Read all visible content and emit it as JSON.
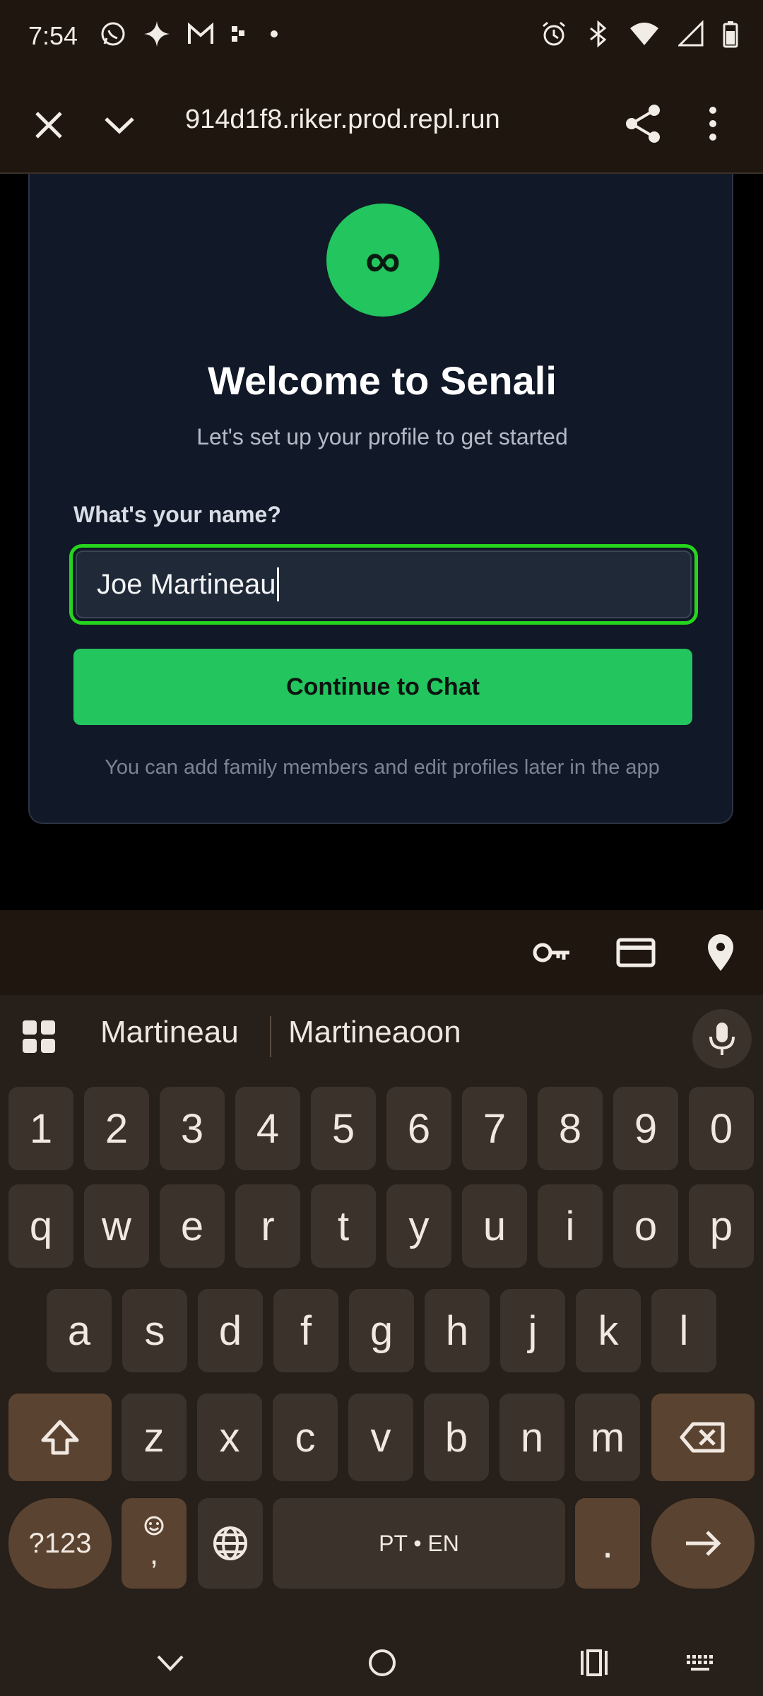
{
  "status_bar": {
    "time": "7:54"
  },
  "browser": {
    "url": "914d1f8.riker.prod.repl.run"
  },
  "card": {
    "logo_symbol": "∞",
    "title": "Welcome to Senali",
    "subtitle": "Let's set up your profile to get started",
    "name_label": "What's your name?",
    "name_value": "Joe Martineau",
    "continue_label": "Continue to Chat",
    "hint": "You can add family members and edit profiles later in the app"
  },
  "keyboard": {
    "suggestions": [
      "Martineau",
      "Martineaoon"
    ],
    "row_numbers": [
      "1",
      "2",
      "3",
      "4",
      "5",
      "6",
      "7",
      "8",
      "9",
      "0"
    ],
    "row1": [
      "q",
      "w",
      "e",
      "r",
      "t",
      "y",
      "u",
      "i",
      "o",
      "p"
    ],
    "row2": [
      "a",
      "s",
      "d",
      "f",
      "g",
      "h",
      "j",
      "k",
      "l"
    ],
    "row3": [
      "z",
      "x",
      "c",
      "v",
      "b",
      "n",
      "m"
    ],
    "symbols_label": "?123",
    "comma_label": ",",
    "space_label": "PT • EN",
    "period_label": "."
  },
  "icons": {
    "status": [
      "whatsapp-icon",
      "sparkle-icon",
      "gmail-icon",
      "dots-icon",
      "notification-dot-icon",
      "alarm-icon",
      "bluetooth-icon",
      "wifi-icon",
      "signal-icon",
      "battery-icon"
    ],
    "autofill": [
      "key-icon",
      "card-icon",
      "location-icon"
    ]
  }
}
